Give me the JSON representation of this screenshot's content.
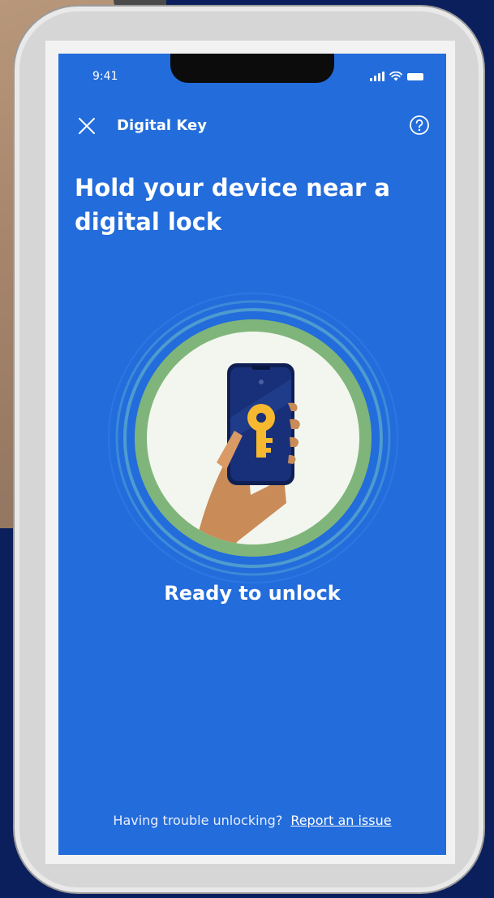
{
  "status_bar": {
    "time": "9:41",
    "icons": [
      "signal-icon",
      "wifi-icon",
      "battery-icon"
    ]
  },
  "header": {
    "close_icon": "close-icon",
    "title": "Digital Key",
    "help_icon": "help-icon"
  },
  "main": {
    "headline": "Hold your device near a digital lock",
    "illustration_icon": "hand-holding-phone-key-icon",
    "status": "Ready to unlock"
  },
  "footer": {
    "prompt": "Having trouble unlocking?",
    "link_label": "Report an issue"
  },
  "colors": {
    "screen_bg": "#236cdb",
    "ring_green": "#7fb57a",
    "key_yellow": "#f5b82e",
    "page_bg": "#0b1f5c"
  }
}
